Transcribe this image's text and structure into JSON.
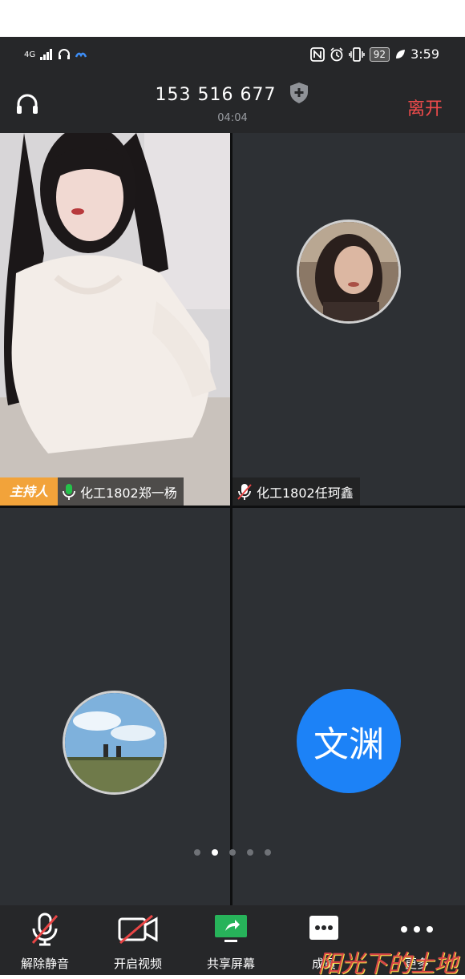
{
  "status_bar": {
    "network": "4G",
    "battery": "92",
    "time": "3:59"
  },
  "header": {
    "meeting_id": "153 516 677",
    "timer": "04:04",
    "leave_label": "离开"
  },
  "participants": [
    {
      "host_badge": "主持人",
      "name": "化工1802郑一杨",
      "mic": "on"
    },
    {
      "name": "化工1802任珂鑫",
      "mic": "muted"
    },
    {
      "name": ""
    },
    {
      "avatar_text": "文渊"
    }
  ],
  "pagination": {
    "total": 5,
    "active": 2
  },
  "toolbar": {
    "unmute_label": "解除静音",
    "video_label": "开启视频",
    "share_label": "共享屏幕",
    "members_label": "成员",
    "more_label": "更多"
  },
  "watermark": "阳光下的土地",
  "colors": {
    "leave": "#ee4b4b",
    "host_badge": "#f2a33a",
    "avatar_blue": "#1c82f7",
    "share_green": "#27b35a",
    "mic_green": "#25c24a"
  }
}
